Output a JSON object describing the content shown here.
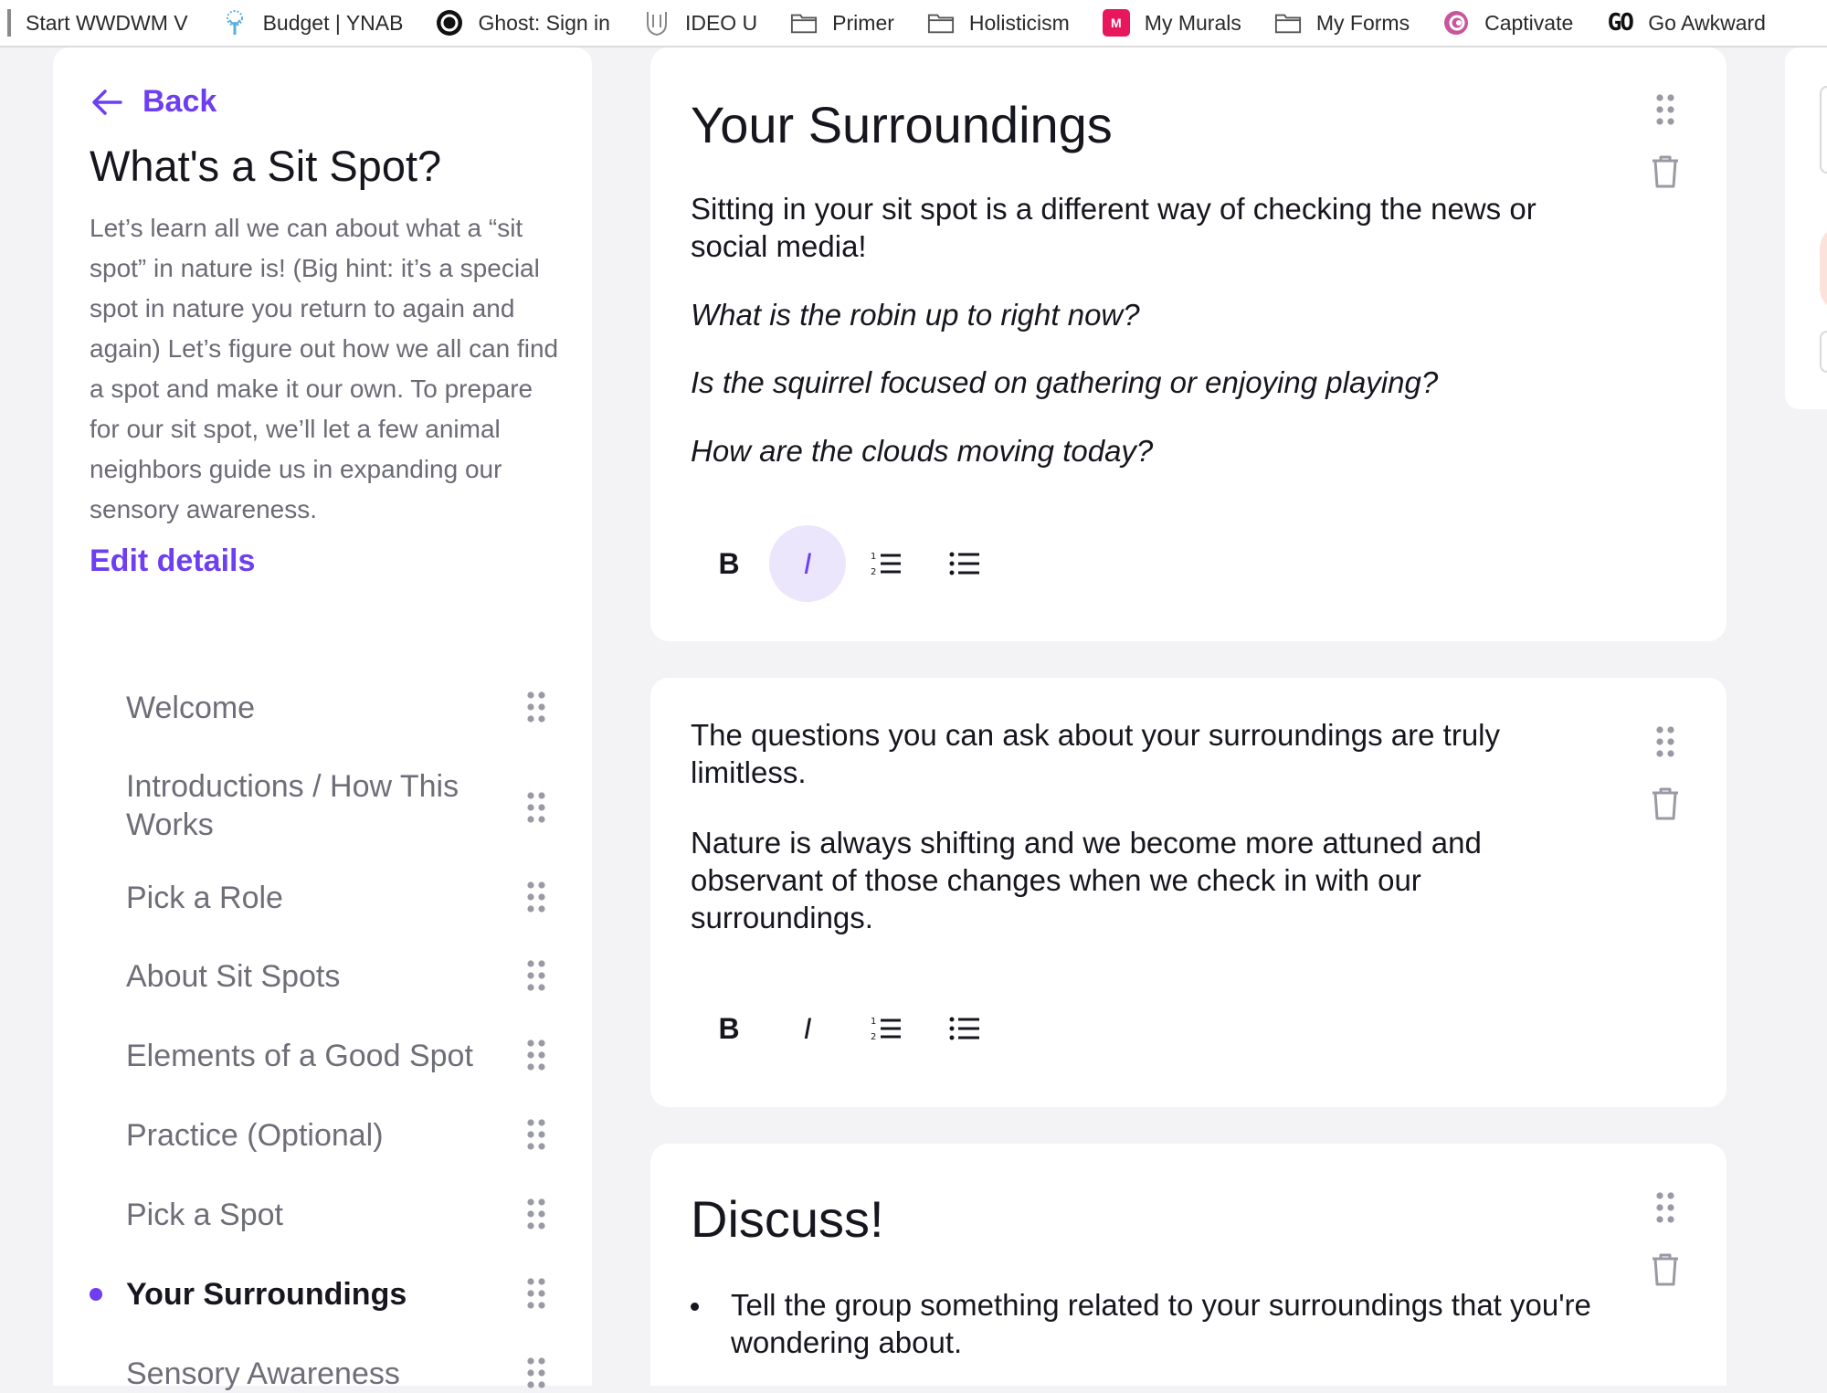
{
  "bookmarks": [
    {
      "label": "Start WWDWM V",
      "icon": "edge-bar"
    },
    {
      "label": "Budget | YNAB",
      "icon": "tree-icon"
    },
    {
      "label": "Ghost: Sign in",
      "icon": "ghost-icon"
    },
    {
      "label": "IDEO U",
      "icon": "shield-icon"
    },
    {
      "label": "Primer",
      "icon": "folder-icon"
    },
    {
      "label": "Holisticism",
      "icon": "folder-icon"
    },
    {
      "label": "My Murals",
      "icon": "mural-icon",
      "icon_text": "M"
    },
    {
      "label": "My Forms",
      "icon": "folder-icon"
    },
    {
      "label": "Captivate",
      "icon": "captivate-icon"
    },
    {
      "label": "Go Awkward",
      "icon": "go-icon",
      "icon_text": "GO"
    }
  ],
  "sidebar": {
    "back_label": "Back",
    "title": "What's a Sit Spot?",
    "description": "Let’s learn all we can about what a “sit spot” in nature is! (Big hint: it’s a special spot in nature you return to again and again) Let’s figure out how we all can find a spot and make it our own. To prepare for our sit spot, we’ll let a few animal neighbors guide us in expanding our sensory awareness.",
    "edit_label": "Edit details",
    "items": [
      {
        "label": "Welcome",
        "active": false
      },
      {
        "label": "Introductions / How This Works",
        "active": false
      },
      {
        "label": "Pick a Role",
        "active": false
      },
      {
        "label": "About Sit Spots",
        "active": false
      },
      {
        "label": "Elements of a Good Spot",
        "active": false
      },
      {
        "label": "Practice (Optional)",
        "active": false
      },
      {
        "label": "Pick a Spot",
        "active": false
      },
      {
        "label": "Your Surroundings",
        "active": true
      },
      {
        "label": "Sensory Awareness",
        "active": false
      }
    ]
  },
  "cards": {
    "card1": {
      "heading": "Your Surroundings",
      "paragraph": "Sitting in your sit spot is a different way of checking the news or social media!",
      "question1": "What is the robin up to right now?",
      "question2": "Is the squirrel focused on gathering or enjoying playing?",
      "question3": "How are the clouds moving today?"
    },
    "card2": {
      "paragraph1": "The questions you can ask about your surroundings are truly limitless.",
      "paragraph2": "Nature is always shifting and we become more attuned and observant of those changes when we check in with our surroundings."
    },
    "card3": {
      "heading": "Discuss!",
      "bullet1": "Tell the group something related to your surroundings that you're wondering about."
    }
  },
  "toolbar": {
    "bold_label": "B",
    "italic_label": "I",
    "ordered_list_icon": "ordered-list-icon",
    "bullet_list_icon": "bullet-list-icon"
  },
  "colors": {
    "accent": "#6d3ff0",
    "accent_light": "#ece6fd",
    "muted_text": "#6e6e78",
    "dark_text": "#16161e"
  }
}
